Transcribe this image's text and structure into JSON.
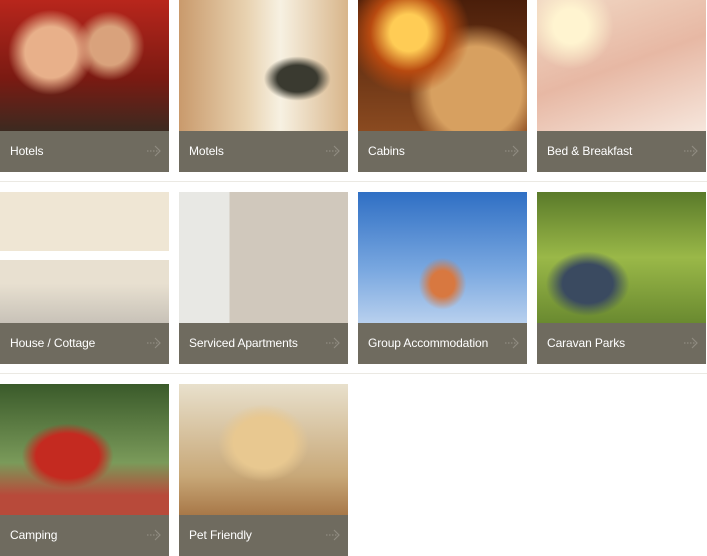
{
  "tiles": [
    {
      "label": "Hotels",
      "icon": "arrow-right-icon"
    },
    {
      "label": "Motels",
      "icon": "arrow-right-icon"
    },
    {
      "label": "Cabins",
      "icon": "arrow-right-icon"
    },
    {
      "label": "Bed & Breakfast",
      "icon": "arrow-right-icon"
    },
    {
      "label": "House / Cottage",
      "icon": "arrow-right-icon"
    },
    {
      "label": "Serviced Apartments",
      "icon": "arrow-right-icon"
    },
    {
      "label": "Group Accommodation",
      "icon": "arrow-right-icon"
    },
    {
      "label": "Caravan Parks",
      "icon": "arrow-right-icon"
    },
    {
      "label": "Camping",
      "icon": "arrow-right-icon"
    },
    {
      "label": "Pet Friendly",
      "icon": "arrow-right-icon"
    }
  ],
  "colors": {
    "label_bar": "#6f6b5f",
    "arrow": "#8f8b80",
    "separator": "#ebe9e3"
  }
}
